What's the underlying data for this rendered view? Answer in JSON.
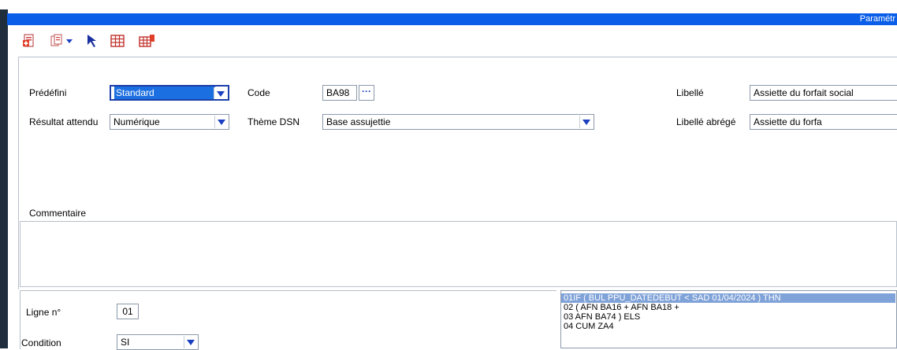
{
  "window": {
    "title": "Paramétr"
  },
  "toolbar": {
    "icons": [
      "new-document-icon",
      "copy-dropdown-icon",
      "pointer-arrow-icon",
      "grid-icon",
      "grid-delete-icon"
    ]
  },
  "form": {
    "predefini": {
      "label": "Prédéfini",
      "value": "Standard"
    },
    "code": {
      "label": "Code",
      "value": "BA98",
      "button": "···"
    },
    "libelle": {
      "label": "Libellé",
      "value": "Assiette du forfait social"
    },
    "resultat": {
      "label": "Résultat attendu",
      "value": "Numérique"
    },
    "theme": {
      "label": "Thème DSN",
      "value": "Base assujettie"
    },
    "libelle_abrege": {
      "label": "Libellé abrégé",
      "value": "Assiette du forfa"
    },
    "commentaire": {
      "label": "Commentaire",
      "value": ""
    }
  },
  "line_editor": {
    "ligne": {
      "label": "Ligne n°",
      "value": "01"
    },
    "condition": {
      "label": "Condition",
      "value": "SI"
    }
  },
  "code_lines": [
    "01IF ( BUL PPU_DATEDEBUT < SAD 01/04/2024 ) THN",
    "02 ( AFN BA16 + AFN BA18  +",
    "03  AFN BA74    ) ELS",
    "04  CUM ZA4"
  ],
  "colors": {
    "title_bar": "#0a5ee8",
    "selection": "#1c6fe0",
    "combo_arrow": "#1a3fbf",
    "code_selection": "#7fa2d8"
  }
}
